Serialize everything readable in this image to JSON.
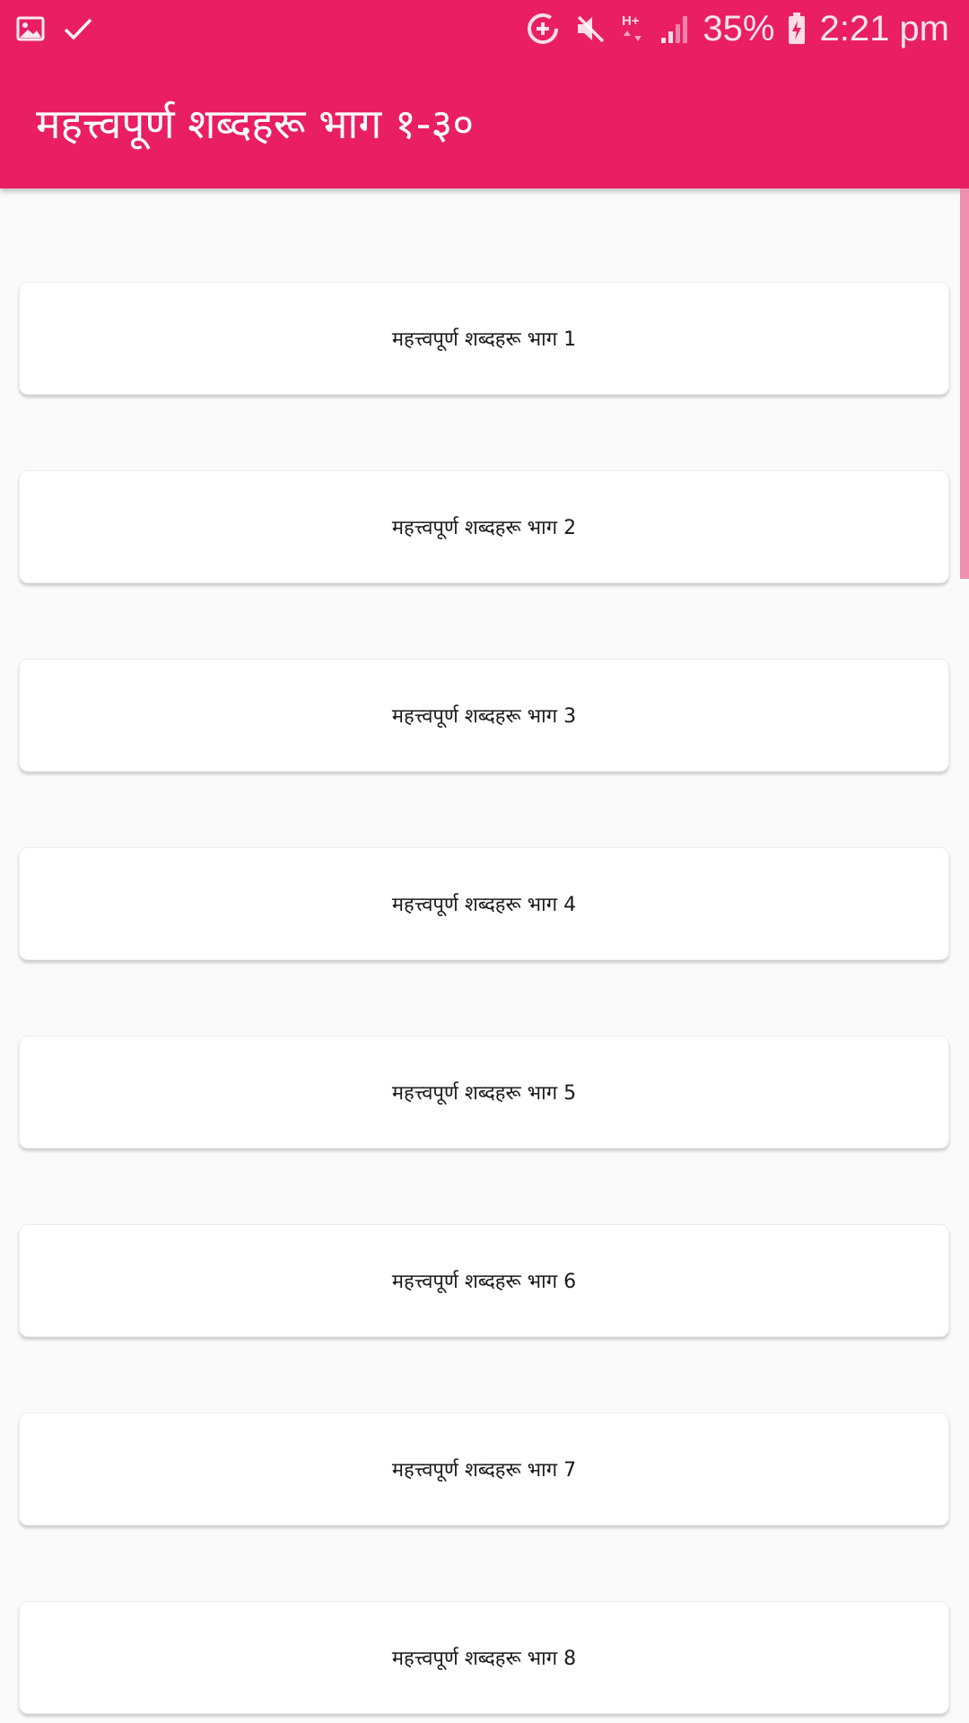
{
  "status_bar": {
    "battery_percent": "35%",
    "time": "2:21 pm",
    "left_icons": [
      "image-icon",
      "check-icon"
    ],
    "right_icons": [
      "data-saver-icon",
      "mute-icon",
      "hplus-network-icon",
      "signal-icon",
      "battery-charging-icon"
    ]
  },
  "app_bar": {
    "title": "महत्त्वपूर्ण शब्दहरू भाग १-३०",
    "color": "#e91e63"
  },
  "list": {
    "items": [
      {
        "label": "महत्त्वपूर्ण शब्दहरू भाग 1"
      },
      {
        "label": "महत्त्वपूर्ण शब्दहरू भाग 2"
      },
      {
        "label": "महत्त्वपूर्ण शब्दहरू भाग 3"
      },
      {
        "label": "महत्त्वपूर्ण शब्दहरू भाग 4"
      },
      {
        "label": "महत्त्वपूर्ण शब्दहरू भाग 5"
      },
      {
        "label": "महत्त्वपूर्ण शब्दहरू भाग 6"
      },
      {
        "label": "महत्त्वपूर्ण शब्दहरू भाग 7"
      },
      {
        "label": "महत्त्वपूर्ण शब्दहरू भाग 8"
      }
    ]
  }
}
